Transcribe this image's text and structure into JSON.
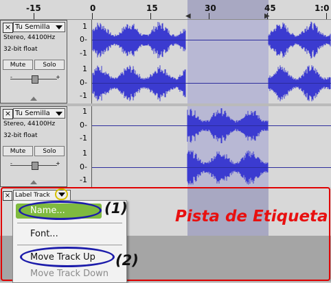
{
  "ruler": {
    "ticks": [
      "-15",
      "0",
      "15",
      "30",
      "45",
      "1:0"
    ]
  },
  "tracks": [
    {
      "name": "Tu Semilla",
      "format": "Stereo, 44100Hz",
      "bits": "32-bit float",
      "mute": "Mute",
      "solo": "Solo",
      "scale": [
        "1",
        "0-",
        "-1",
        "1",
        "0-",
        "-1"
      ]
    },
    {
      "name": "Tu Semilla",
      "format": "Stereo, 44100Hz",
      "bits": "32-bit float",
      "mute": "Mute",
      "solo": "Solo",
      "scale": [
        "1",
        "0-",
        "-1",
        "1",
        "0-",
        "-1"
      ]
    }
  ],
  "label_track": {
    "name": "Label Track",
    "close": "×",
    "close2": "×"
  },
  "annotations": {
    "title": "Pista de Etiqueta",
    "n1": "(1)",
    "n2": "(2)"
  },
  "menu": {
    "name": "Name...",
    "font": "Font...",
    "move_up": "Move Track Up",
    "move_down": "Move Track Down"
  },
  "slider": {
    "minus": "-",
    "plus": "+"
  },
  "colors": {
    "wave": "#3b3bd0",
    "selection": "#b8b8d4",
    "highlight": "#7fba3f",
    "callout": "#e81010"
  }
}
